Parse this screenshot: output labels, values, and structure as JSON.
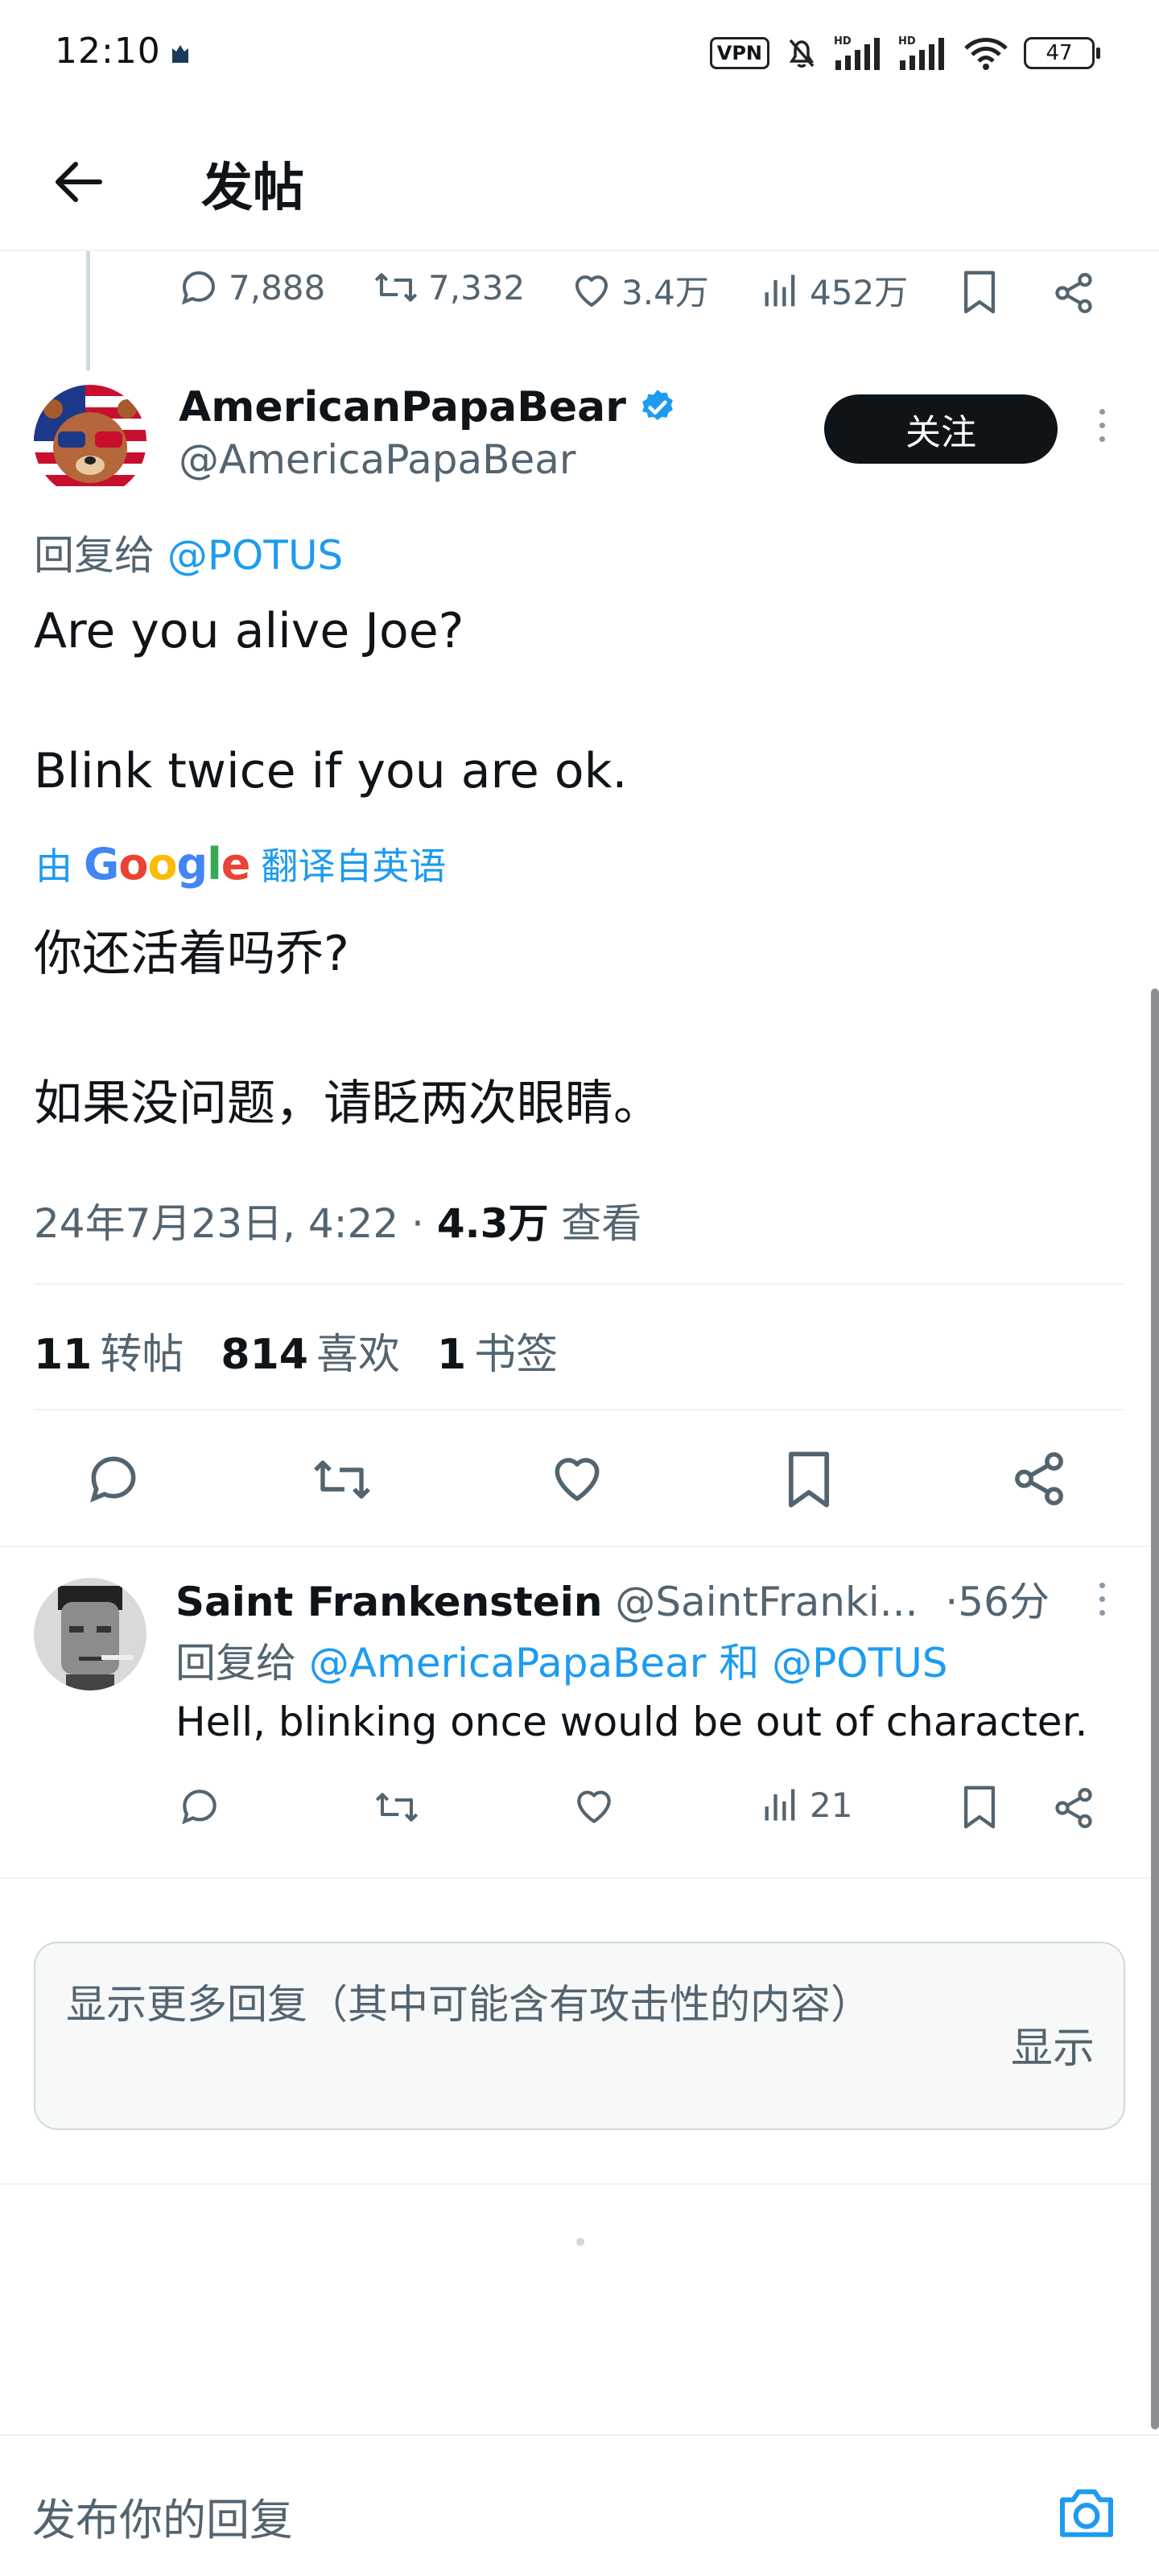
{
  "status_bar": {
    "time": "12:10",
    "vpn": "VPN",
    "battery": "47",
    "icons": [
      "cat-app-icon",
      "mute-icon",
      "hd-signal-icon",
      "hd-signal-icon",
      "wifi-icon"
    ]
  },
  "header": {
    "title": "发帖",
    "back_icon": "arrow-left-icon"
  },
  "parent_tweet_actions": {
    "replies": "7,888",
    "retweets": "7,332",
    "likes": "3.4万",
    "views": "452万"
  },
  "main_tweet": {
    "author_name": "AmericanPapaBear",
    "author_handle": "@AmericaPapaBear",
    "verified": true,
    "follow_label": "关注",
    "reply_to_prefix": "回复给",
    "reply_to_handle": "@POTUS",
    "text_line1": "Are you alive Joe?",
    "text_line2": "Blink twice if you are ok.",
    "translate_prefix": "由",
    "translate_brand": "Google",
    "translate_suffix": "翻译自英语",
    "translated_line1": "你还活着吗乔?",
    "translated_line2": "如果没问题，请眨两次眼睛。",
    "timestamp": "24年7月23日, 4:22 · ",
    "views_count": "4.3万",
    "views_label": " 查看",
    "stats": {
      "retweets_count": "11",
      "retweets_label": "转帖",
      "likes_count": "814",
      "likes_label": "喜欢",
      "bookmarks_count": "1",
      "bookmarks_label": "书签"
    }
  },
  "reply_tweet": {
    "author_name": "Saint Frankenstein",
    "author_handle": "@SaintFranki...",
    "time": "·56分",
    "reply_to_prefix": "回复给",
    "reply_to_handle1": "@AmericaPapaBear",
    "reply_to_joiner": "和",
    "reply_to_handle2": "@POTUS",
    "text": "Hell, blinking once would be out of character.",
    "views": "21"
  },
  "show_more": {
    "text": "显示更多回复（其中可能含有攻击性的内容）",
    "button": "显示"
  },
  "compose": {
    "placeholder": "发布你的回复",
    "camera_icon": "camera-icon"
  },
  "colors": {
    "accent": "#1d9bf0",
    "text_primary": "#0f1419",
    "text_secondary": "#536471",
    "follow_bg": "#0f1419"
  }
}
